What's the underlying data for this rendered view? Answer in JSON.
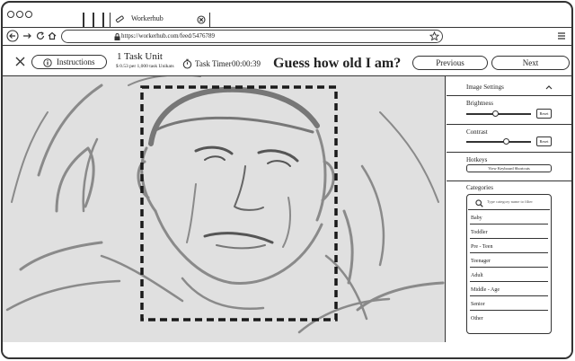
{
  "browser": {
    "tab_title": "Workerhub",
    "url": "https://workerhub.com/feed/5476789"
  },
  "toolbar": {
    "instructions_label": "Instructions",
    "task_unit_title": "1 Task Unit",
    "task_unit_sub": "$ 0.53 per 1,000 task Unikats",
    "timer_label": "Task Timer",
    "timer_value": "00:00:39",
    "headline": "Guess how old I am?",
    "previous_label": "Previous",
    "next_label": "Next"
  },
  "panel": {
    "image_settings_title": "Image Settings",
    "brightness_label": "Brightness",
    "brightness_value": 0.45,
    "contrast_label": "Contrast",
    "contrast_value": 0.62,
    "reset_label": "Reset",
    "hotkeys_label": "Hotkeys",
    "keyboard_shortcuts_label": "View Keyboard Shortcuts",
    "categories_label": "Categories",
    "category_search_placeholder": "Type category name to filter",
    "categories": [
      "Baby",
      "Toddler",
      "Pre - Teen",
      "Teenager",
      "Adult",
      "Middle - Age",
      "Senior",
      "Other"
    ]
  },
  "icons": {
    "tab": "pencil-icon",
    "tab_close": "close-circle-icon",
    "back": "back-arrow-icon",
    "forward": "forward-arrow-icon",
    "reload": "reload-icon",
    "home": "home-icon",
    "lock": "lock-icon",
    "bookmark": "star-icon",
    "menu": "hamburger-menu-icon",
    "instructions": "info-circle-icon",
    "timer": "stopwatch-icon",
    "collapse": "chevron-up-icon",
    "search": "search-icon"
  }
}
